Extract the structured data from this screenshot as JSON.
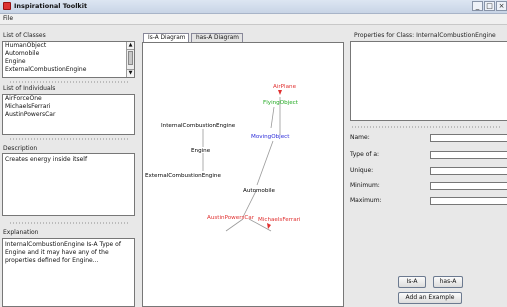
{
  "window": {
    "title": "Inspirational Toolkit",
    "controls": [
      "_",
      "□",
      "×"
    ]
  },
  "menu": {
    "items": [
      "File"
    ]
  },
  "classes_panel": {
    "title": "List of Classes",
    "items": [
      "HumanObject",
      "Automobile",
      "Engine",
      "ExternalCombustionEngine"
    ]
  },
  "individuals_panel": {
    "title": "List of Individuals",
    "items": [
      "AirForceOne",
      "MichaelsFerrari",
      "AustinPowersCar"
    ]
  },
  "description_panel": {
    "title": "Description",
    "text": "Creates energy inside itself"
  },
  "explanation_panel": {
    "title": "Explanation",
    "text": "InternalCombustionEngine Is-A Type of Engine and it may have any of the properties defined for Engine..."
  },
  "tabs": [
    {
      "label": "Is-A Diagram",
      "active": true
    },
    {
      "label": "has-A Diagram",
      "active": false
    }
  ],
  "diagram": {
    "nodes": {
      "airplane": {
        "label": "AirPlane",
        "color": "#e03030"
      },
      "flying_object": {
        "label": "FlyingObject",
        "color": "#22aa22"
      },
      "moving_object": {
        "label": "MovingObject",
        "color": "#2a2ad8"
      },
      "ice": {
        "label": "InternalCombustionEngine",
        "color": "#000000"
      },
      "engine": {
        "label": "Engine",
        "color": "#000000"
      },
      "ece": {
        "label": "ExternalCombustionEngine",
        "color": "#000000"
      },
      "automobile": {
        "label": "Automobile",
        "color": "#000000"
      },
      "austin": {
        "label": "AustinPowersCar",
        "color": "#e03030"
      },
      "ferrari": {
        "label": "MichaelsFerrari",
        "color": "#e03030"
      }
    }
  },
  "properties_panel": {
    "title": "Properties for Class: InternalCombustionEngine",
    "fields": [
      {
        "label": "Name:",
        "value": ""
      },
      {
        "label": "Type of a:",
        "value": ""
      },
      {
        "label": "Unique:",
        "value": ""
      },
      {
        "label": "Minimum:",
        "value": ""
      },
      {
        "label": "Maximum:",
        "value": ""
      }
    ]
  },
  "buttons": {
    "is_a": "Is-A",
    "has_a": "has-A",
    "add_example": "Add an Example"
  }
}
